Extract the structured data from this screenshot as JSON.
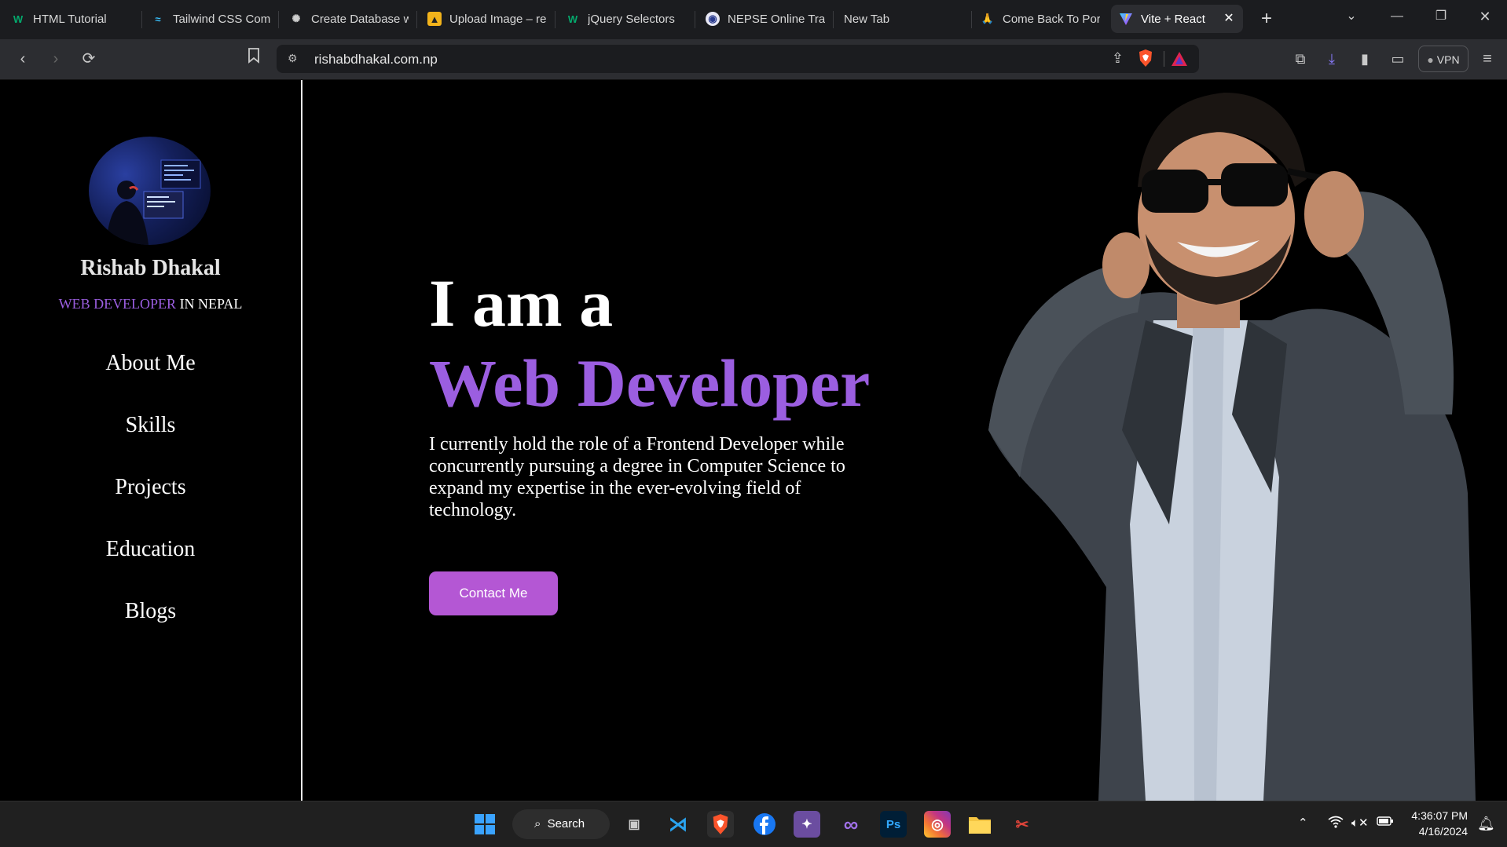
{
  "browser": {
    "tabs": [
      {
        "label": "HTML Tutorial",
        "icon": "w3schools-icon"
      },
      {
        "label": "Tailwind CSS Com",
        "icon": "tailwind-icon"
      },
      {
        "label": "Create Database w",
        "icon": "chatgpt-icon"
      },
      {
        "label": "Upload Image – re",
        "icon": "upload-icon"
      },
      {
        "label": "jQuery Selectors",
        "icon": "w3schools-icon"
      },
      {
        "label": "NEPSE Online Trad",
        "icon": "nepse-icon"
      },
      {
        "label": "New Tab",
        "icon": ""
      },
      {
        "label": "Come Back To Por",
        "icon": "bell-icon"
      },
      {
        "label": "Vite + React",
        "icon": "vite-icon",
        "active": true
      }
    ],
    "url": "rishabdhakal.com.np",
    "vpn_label": "VPN"
  },
  "sidebar": {
    "name": "Rishab Dhakal",
    "role_accent": "WEB DEVELOPER",
    "role_rest": " IN NEPAL",
    "nav": [
      "About Me",
      "Skills",
      "Projects",
      "Education",
      "Blogs"
    ]
  },
  "hero": {
    "line1": "I am a",
    "line2": "Web Developer",
    "description": "I currently hold the role of a Frontend Developer while concurrently pursuing a degree in Computer Science to expand my expertise in the ever-evolving field of technology.",
    "cta_label": "Contact Me"
  },
  "taskbar": {
    "search_label": "Search",
    "time": "4:36:07 PM",
    "date": "4/16/2024"
  },
  "colors": {
    "accent": "#9b5ee0",
    "button": "#b457d4",
    "background": "#000000"
  }
}
